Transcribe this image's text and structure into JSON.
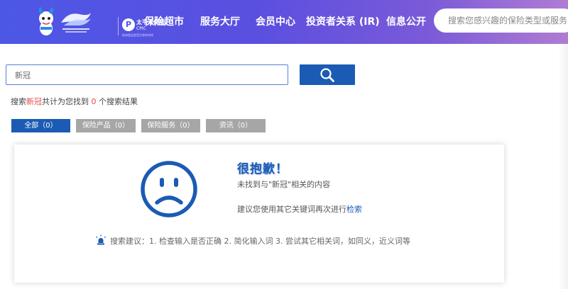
{
  "header": {
    "brand": {
      "cpic_mark": "P",
      "cpic_name": "太平洋保险",
      "cpic_en": "CPIC",
      "cpic_sub": "杭州亚运会官方合作伙伴"
    },
    "nav": [
      {
        "label": "保险超市"
      },
      {
        "label": "服务大厅"
      },
      {
        "label": "会员中心"
      },
      {
        "label": "投资者关系 (IR)"
      },
      {
        "label": "信息公开"
      }
    ],
    "search_placeholder": "搜索您感兴趣的保险类型或服务"
  },
  "search": {
    "query": "新冠",
    "button_icon": "magnifier-icon"
  },
  "result": {
    "prefix": "搜索",
    "keyword": "新冠",
    "middle": "共计为您找到 ",
    "count": "0",
    "suffix": " 个搜索结果"
  },
  "tabs": [
    {
      "label": "全部（0）",
      "active": true
    },
    {
      "label": "保险产品（0）",
      "active": false
    },
    {
      "label": "保险服务（0）",
      "active": false
    },
    {
      "label": "资讯（0）",
      "active": false
    }
  ],
  "empty_state": {
    "icon": "sad-face-icon",
    "title": "很抱歉！",
    "message": "未找到与\"新冠\"相关的内容",
    "suggest_prefix": "建议您使用其它关键词再次进行",
    "suggest_link": "检索",
    "tips_icon": "lightbulb-icon",
    "tips": "搜索建议：1. 检查输入是否正确  2. 简化输入词  3. 尝试其它相关词，如同义，近义词等"
  },
  "colors": {
    "primary": "#1b5bb3",
    "highlight": "#e24b4b",
    "tab_inactive": "#a6a6a6"
  }
}
